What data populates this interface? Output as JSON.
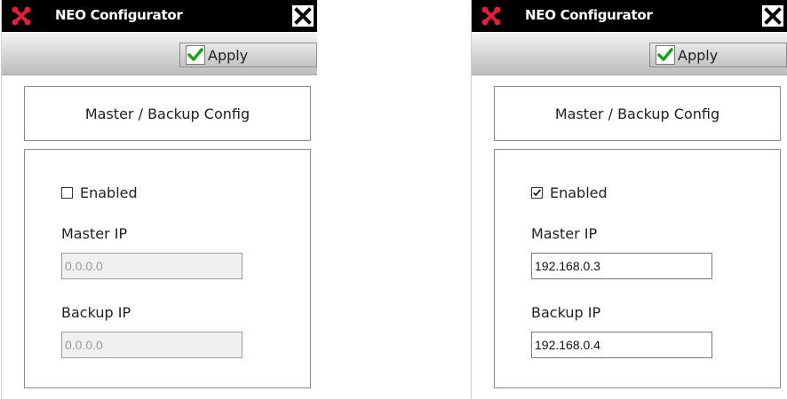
{
  "windows": [
    {
      "title": "NEO Configurator",
      "apply_label": "Apply",
      "section_title": "Master / Backup Config",
      "enabled_label": "Enabled",
      "enabled": false,
      "master_ip_label": "Master IP",
      "master_ip_value": "0.0.0.0",
      "backup_ip_label": "Backup IP",
      "backup_ip_value": "0.0.0.0"
    },
    {
      "title": "NEO Configurator",
      "apply_label": "Apply",
      "section_title": "Master / Backup Config",
      "enabled_label": "Enabled",
      "enabled": true,
      "master_ip_label": "Master IP",
      "master_ip_value": "192.168.0.3",
      "backup_ip_label": "Backup IP",
      "backup_ip_value": "192.168.0.4"
    }
  ],
  "icons": {
    "app": "neo-logo-icon",
    "close": "close-icon",
    "apply": "check-icon"
  },
  "colors": {
    "titlebar_bg": "#000000",
    "logo_red": "#e0203a",
    "apply_check_green": "#1f9e1f"
  }
}
